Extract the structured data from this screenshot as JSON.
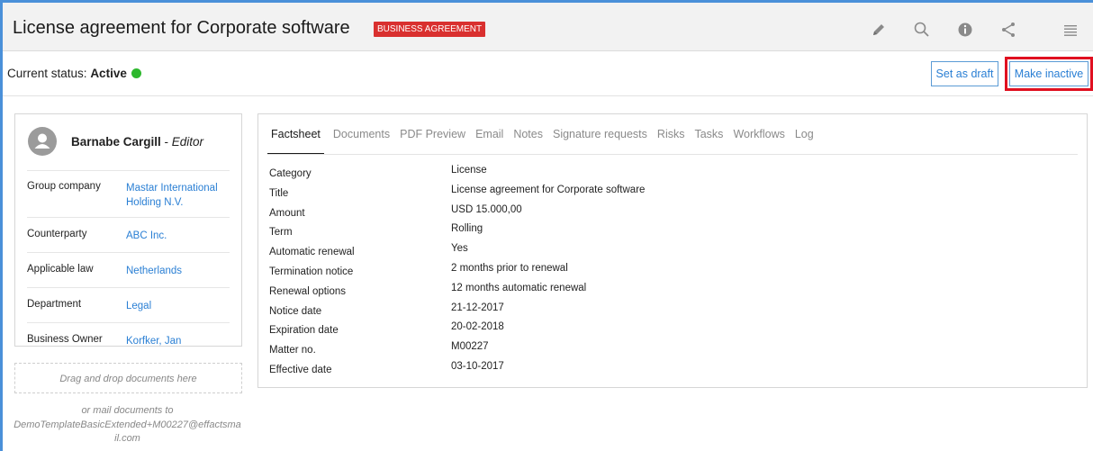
{
  "header": {
    "title": "License agreement for Corporate software",
    "badge": "BUSINESS AGREEMENT",
    "tools": [
      "pencil-icon",
      "search-icon",
      "info-icon",
      "share-icon",
      "menu-icon"
    ]
  },
  "status": {
    "label": "Current status:",
    "value": "Active",
    "color": "#2eb82e"
  },
  "actions": {
    "set_draft": "Set as draft",
    "make_inactive": "Make inactive"
  },
  "profile": {
    "name": "Barnabe Cargill",
    "separator": " - ",
    "role": "Editor"
  },
  "info": [
    {
      "label": "Group company",
      "value": "Mastar International Holding N.V."
    },
    {
      "label": "Counterparty",
      "value": "ABC Inc."
    },
    {
      "label": "Applicable law",
      "value": "Netherlands"
    },
    {
      "label": "Department",
      "value": "Legal"
    },
    {
      "label": "Business Owner",
      "value": "Korfker, Jan"
    }
  ],
  "dropzone": {
    "text": "Drag and drop documents here",
    "mail_line1": "or mail documents to",
    "mail_line2": "DemoTemplateBasicExtended+M00227@effactsma",
    "mail_line3": "il.com"
  },
  "tabs": [
    "Factsheet",
    "Documents",
    "PDF Preview",
    "Email",
    "Notes",
    "Signature requests",
    "Risks",
    "Tasks",
    "Workflows",
    "Log"
  ],
  "facts": [
    {
      "key": "Category",
      "value": "License"
    },
    {
      "key": "Title",
      "value": "License agreement for Corporate software"
    },
    {
      "key": "Amount",
      "value": "USD 15.000,00"
    },
    {
      "key": "Term",
      "value": "Rolling"
    },
    {
      "key": "Automatic renewal",
      "value": "Yes"
    },
    {
      "key": "Termination notice",
      "value": "2 months prior to renewal"
    },
    {
      "key": "Renewal options",
      "value": "12 months automatic renewal"
    },
    {
      "key": "Notice date",
      "value": "21-12-2017"
    },
    {
      "key": "Expiration date",
      "value": "20-02-2018"
    },
    {
      "key": "Matter no.",
      "value": "M00227"
    },
    {
      "key": "Effective date",
      "value": "03-10-2017"
    }
  ],
  "colors": {
    "accent": "#2a7fd4",
    "badge": "#d9302f",
    "highlight": "#e01020"
  }
}
